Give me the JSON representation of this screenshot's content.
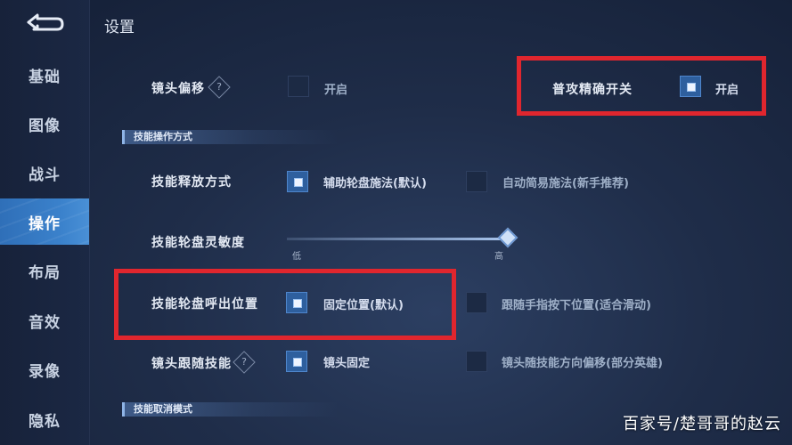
{
  "title": "设置",
  "sidebar": {
    "items": [
      {
        "label": "基础"
      },
      {
        "label": "图像"
      },
      {
        "label": "战斗"
      },
      {
        "label": "操作"
      },
      {
        "label": "布局"
      },
      {
        "label": "音效"
      },
      {
        "label": "录像"
      },
      {
        "label": "隐私"
      }
    ],
    "active": "操作"
  },
  "camera_offset": {
    "label": "镜头偏移",
    "help_icon": "help-icon",
    "option": "开启",
    "checked": false
  },
  "normal_attack_precise": {
    "label": "普攻精确开关",
    "option": "开启",
    "checked": true
  },
  "section_skill_operation": {
    "title": "技能操作方式"
  },
  "skill_release": {
    "label": "技能释放方式",
    "options": [
      {
        "text": "辅助轮盘施法(默认)",
        "checked": true
      },
      {
        "text": "自动简易施法(新手推荐)",
        "checked": false
      }
    ]
  },
  "wheel_sensitivity": {
    "label": "技能轮盘灵敏度",
    "low": "低",
    "high": "高",
    "value": 1.0
  },
  "wheel_position": {
    "label": "技能轮盘呼出位置",
    "options": [
      {
        "text": "固定位置(默认)",
        "checked": true
      },
      {
        "text": "跟随手指按下位置(适合滑动)",
        "checked": false
      }
    ]
  },
  "camera_follow": {
    "label": "镜头跟随技能",
    "help_icon": "help-icon",
    "options": [
      {
        "text": "镜头固定",
        "checked": true
      },
      {
        "text": "镜头随技能方向偏移(部分英雄)",
        "checked": false
      }
    ]
  },
  "section_skill_cancel": {
    "title": "技能取消模式"
  },
  "watermark": "百家号/楚哥哥的赵云",
  "colors": {
    "highlight": "#e0262e",
    "active_tab": "#3b82cc"
  }
}
